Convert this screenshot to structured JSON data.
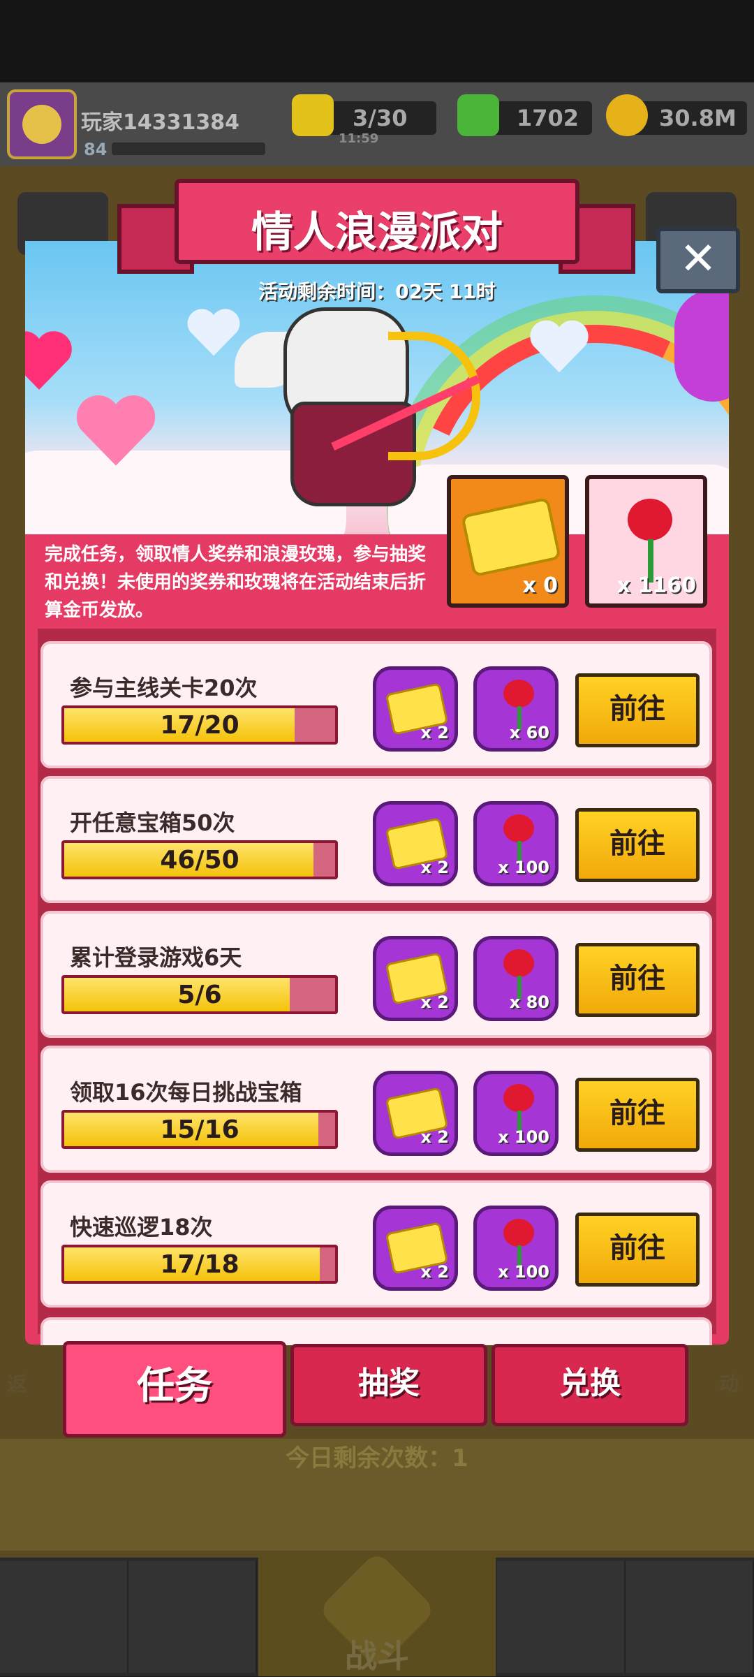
{
  "player": {
    "name": "玩家14331384",
    "level": "84"
  },
  "resources": {
    "energy": "3/30",
    "energy_timer": "11:59",
    "gems": "1702",
    "coins": "30.8M"
  },
  "event": {
    "title": "情人浪漫派对",
    "timer": "活动剩余时间：02天 11时",
    "description": "完成任务，领取情人奖券和浪漫玫瑰，参与抽奖和兑换！未使用的奖券和玫瑰将在活动结束后折算金币发放。",
    "tickets": "x 0",
    "roses": "x 1160",
    "close_label": "✕"
  },
  "tasks": [
    {
      "title": "参与主线关卡20次",
      "progress": "17/20",
      "fraction": 0.85,
      "ticket_reward": "x 2",
      "rose_reward": "x 60",
      "button": "前往"
    },
    {
      "title": "开任意宝箱50次",
      "progress": "46/50",
      "fraction": 0.92,
      "ticket_reward": "x 2",
      "rose_reward": "x 100",
      "button": "前往"
    },
    {
      "title": "累计登录游戏6天",
      "progress": "5/6",
      "fraction": 0.8333,
      "ticket_reward": "x 2",
      "rose_reward": "x 80",
      "button": "前往"
    },
    {
      "title": "领取16次每日挑战宝箱",
      "progress": "15/16",
      "fraction": 0.9375,
      "ticket_reward": "x 2",
      "rose_reward": "x 100",
      "button": "前往"
    },
    {
      "title": "快速巡逻18次",
      "progress": "17/18",
      "fraction": 0.9444,
      "ticket_reward": "x 2",
      "rose_reward": "x 100",
      "button": "前往"
    }
  ],
  "tabs": {
    "task": "任务",
    "lottery": "抽奖",
    "exchange": "兑换"
  },
  "background": {
    "remaining": "今日剩余次数：1",
    "battle": "战斗",
    "left_side": "返",
    "right_side": "动"
  },
  "colors": {
    "accent": "#e43a64",
    "button": "#ffd224",
    "reward_bg": "#a635d6"
  }
}
